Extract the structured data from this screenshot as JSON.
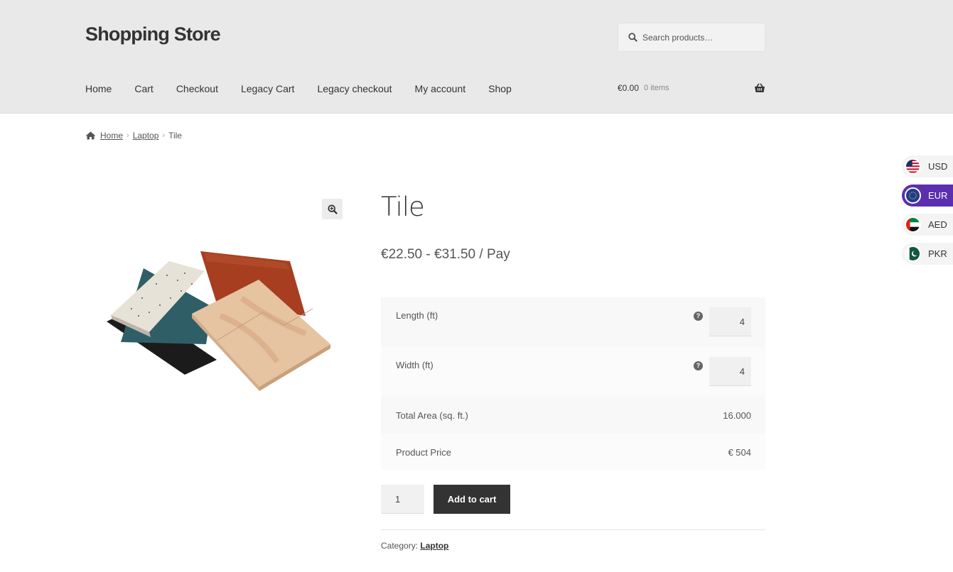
{
  "header": {
    "site_title": "Shopping Store",
    "search_placeholder": "Search products…",
    "nav": [
      "Home",
      "Cart",
      "Checkout",
      "Legacy Cart",
      "Legacy checkout",
      "My account",
      "Shop"
    ],
    "cart_amount": "€0.00",
    "cart_count": "0 items"
  },
  "breadcrumb": {
    "home": "Home",
    "category": "Laptop",
    "current": "Tile",
    "separator": "›"
  },
  "product": {
    "title": "Tile",
    "price": "€22.50 - €31.50 / Pay",
    "calculator": {
      "length_label": "Length (ft)",
      "length_value": "4",
      "width_label": "Width (ft)",
      "width_value": "4",
      "help_glyph": "?",
      "area_label": "Total Area (sq. ft.)",
      "area_value": "16.000",
      "price_label": "Product Price",
      "price_value": "€ 504"
    },
    "quantity": "1",
    "add_to_cart": "Add to cart",
    "category_label": "Category:",
    "category_link": "Laptop"
  },
  "currency_switcher": [
    {
      "code": "USD",
      "flag": "us-flag-icon",
      "active": false
    },
    {
      "code": "EUR",
      "flag": "eu-flag-icon",
      "active": true
    },
    {
      "code": "AED",
      "flag": "uae-flag-icon",
      "active": false
    },
    {
      "code": "PKR",
      "flag": "pakistan-flag-icon",
      "active": false
    }
  ],
  "colors": {
    "header_bg": "#e9e9e9",
    "button_bg": "#333333",
    "active_currency": "#5b2fb0"
  }
}
